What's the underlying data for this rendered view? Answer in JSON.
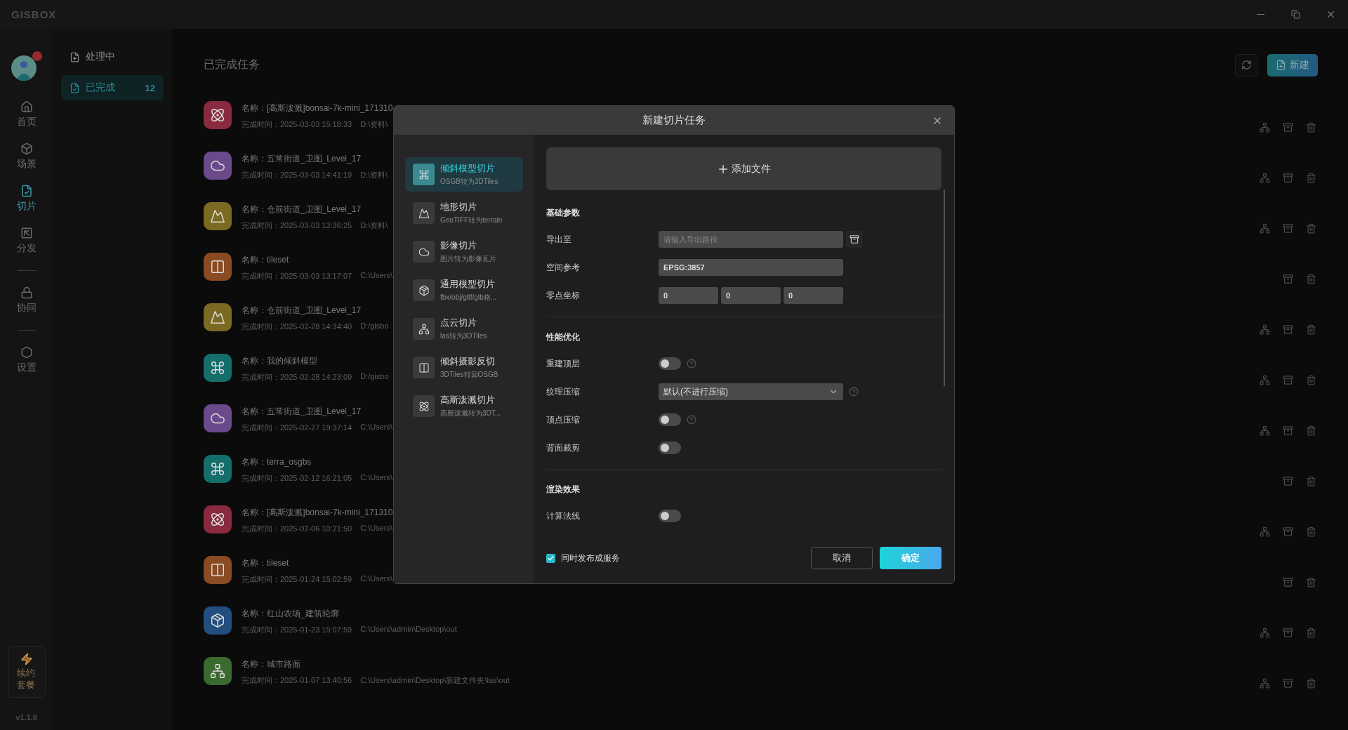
{
  "window": {
    "logo": "GISBOX"
  },
  "nav": {
    "groups": [
      [
        {
          "label": "首页",
          "selected": false
        },
        {
          "label": "场景",
          "selected": false
        },
        {
          "label": "切片",
          "selected": true
        },
        {
          "label": "分发",
          "selected": false
        }
      ],
      [
        {
          "label": "协同",
          "selected": false
        }
      ],
      [
        {
          "label": "设置",
          "selected": false
        }
      ]
    ],
    "renew": "续约套餐",
    "version": "v1.1.8"
  },
  "subnav": {
    "items": [
      {
        "label": "处理中",
        "selected": false
      },
      {
        "label": "已完成",
        "count": "12",
        "selected": true
      }
    ]
  },
  "header": {
    "title": "已完成任务",
    "new_button": "新建"
  },
  "tasks": [
    {
      "kind": "gauss",
      "color": "#8a2a3e",
      "name": "名称：[高斯泼溅]bonsai-7k-mini_171310",
      "time": "完成时间：2025-03-03 15:18:33",
      "path": "D:\\资料\\",
      "publish": true
    },
    {
      "kind": "imagery",
      "color": "#6a4a8a",
      "name": "名称：五常街道_卫图_Level_17",
      "time": "完成时间：2025-03-03 14:41:19",
      "path": "D:\\资料\\",
      "publish": true
    },
    {
      "kind": "terrain",
      "color": "#7a6a22",
      "name": "名称：仓前街道_卫图_Level_17",
      "time": "完成时间：2025-03-03 13:36:25",
      "path": "D:\\资料\\",
      "publish": true
    },
    {
      "kind": "reverse",
      "color": "#8a4a22",
      "name": "名称：tileset",
      "time": "完成时间：2025-03-03 13:17:07",
      "path": "C:\\Users\\",
      "publish": false
    },
    {
      "kind": "terrain",
      "color": "#7a6a22",
      "name": "名称：仓前街道_卫图_Level_17",
      "time": "完成时间：2025-02-28 14:34:40",
      "path": "D:/gisbo",
      "publish": true
    },
    {
      "kind": "oblique",
      "color": "#146e6a",
      "name": "名称：我的倾斜模型",
      "time": "完成时间：2025-02-28 14:23:09",
      "path": "D:/gisbo",
      "publish": true
    },
    {
      "kind": "imagery",
      "color": "#6a4a8a",
      "name": "名称：五常街道_卫图_Level_17",
      "time": "完成时间：2025-02-27 19:37:14",
      "path": "C:\\Users\\",
      "publish": true
    },
    {
      "kind": "oblique",
      "color": "#146e6a",
      "name": "名称：terra_osgbs",
      "time": "完成时间：2025-02-12 16:21:05",
      "path": "C:\\Users\\",
      "publish": false
    },
    {
      "kind": "gauss",
      "color": "#8a2a3e",
      "name": "名称：[高斯泼溅]bonsai-7k-mini_171310",
      "time": "完成时间：2025-02-06 10:21:50",
      "path": "C:\\Users\\",
      "publish": true
    },
    {
      "kind": "reverse",
      "color": "#8a4a22",
      "name": "名称：tileset",
      "time": "完成时间：2025-01-24 15:02:59",
      "path": "C:\\Users\\",
      "publish": false
    },
    {
      "kind": "model",
      "color": "#234f80",
      "name": "名称：红山农场_建筑轮廓",
      "time": "完成时间：2025-01-23 15:07:59",
      "path": "C:\\Users\\admin\\Desktop\\out",
      "publish": true
    },
    {
      "kind": "pointcloud",
      "color": "#3a6a30",
      "name": "名称：城市路面",
      "time": "完成时间：2025-01-07 13:40:56",
      "path": "C:\\Users\\admin\\Desktop\\新建文件夹\\las\\out",
      "publish": true
    }
  ],
  "dialog": {
    "title": "新建切片任务",
    "types": [
      {
        "kind": "oblique",
        "title": "倾斜模型切片",
        "subtitle": "OSGB转为3DTiles",
        "selected": true
      },
      {
        "kind": "terrain",
        "title": "地形切片",
        "subtitle": "GeoTIFF转为terrain",
        "selected": false
      },
      {
        "kind": "imagery",
        "title": "影像切片",
        "subtitle": "图片转为影像瓦片",
        "selected": false
      },
      {
        "kind": "model",
        "title": "通用模型切片",
        "subtitle": "fbx/obj/gltf/glb格...",
        "selected": false
      },
      {
        "kind": "pointcloud",
        "title": "点云切片",
        "subtitle": "las转为3DTiles",
        "selected": false
      },
      {
        "kind": "reverse",
        "title": "倾斜摄影反切",
        "subtitle": "3DTiles转回OSGB",
        "selected": false
      },
      {
        "kind": "gauss",
        "title": "高斯泼溅切片",
        "subtitle": "高斯泼溅转为3DT...",
        "selected": false
      }
    ],
    "add_file": "添加文件",
    "sections": [
      {
        "title": "基础参数",
        "rows": [
          {
            "kind": "path",
            "label": "导出至",
            "placeholder": "请输入导出路径"
          },
          {
            "kind": "text",
            "label": "空间参考",
            "value": "EPSG:3857"
          },
          {
            "kind": "triple",
            "label": "零点坐标",
            "values": [
              "0",
              "0",
              "0"
            ]
          }
        ]
      },
      {
        "title": "性能优化",
        "rows": [
          {
            "kind": "toggle",
            "label": "重建顶层",
            "on": false,
            "help": true
          },
          {
            "kind": "select",
            "label": "纹理压缩",
            "value": "默认(不进行压缩)",
            "help": true
          },
          {
            "kind": "toggle",
            "label": "顶点压缩",
            "on": false,
            "help": true
          },
          {
            "kind": "toggle",
            "label": "背面裁剪",
            "on": false,
            "help": false
          }
        ]
      },
      {
        "title": "渲染效果",
        "rows": [
          {
            "kind": "toggle",
            "label": "计算法线",
            "on": false,
            "help": false
          }
        ]
      }
    ],
    "publish": {
      "label": "同时发布成服务",
      "checked": true
    },
    "cancel": "取消",
    "confirm": "确定"
  }
}
